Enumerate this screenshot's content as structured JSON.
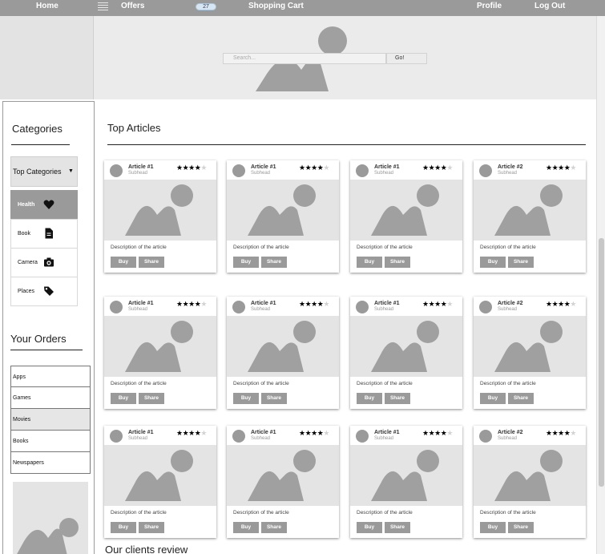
{
  "nav": {
    "home": "Home",
    "offers": "Offers",
    "cart_count": "27",
    "shopping_cart": "Shopping Cart",
    "profile": "Profile",
    "logout": "Log Out"
  },
  "search": {
    "placeholder": "Search...",
    "button": "Go!"
  },
  "sidebar": {
    "categories_title": "Categories",
    "dropdown_label": "Top Categories",
    "categories": [
      {
        "label": "Health",
        "icon": "heart-icon"
      },
      {
        "label": "Book",
        "icon": "document-icon"
      },
      {
        "label": "Camera",
        "icon": "camera-icon"
      },
      {
        "label": "Places",
        "icon": "tag-icon"
      }
    ],
    "orders_title": "Your Orders",
    "orders": [
      "Apps",
      "Games",
      "Movies",
      "Books",
      "Newspapers"
    ],
    "selected_order": "Movies"
  },
  "main": {
    "title": "Top Articles",
    "clients_title": "Our clients review"
  },
  "articles": [
    {
      "title": "Article #1",
      "subhead": "Subhead",
      "rating": 4,
      "description": "Description of the article",
      "buy": "Buy",
      "share": "Share"
    },
    {
      "title": "Article #1",
      "subhead": "Subhead",
      "rating": 4,
      "description": "Description of the article",
      "buy": "Buy",
      "share": "Share"
    },
    {
      "title": "Article #1",
      "subhead": "Subhead",
      "rating": 4,
      "description": "Description of the article",
      "buy": "Buy",
      "share": "Share"
    },
    {
      "title": "Article #2",
      "subhead": "Subhead",
      "rating": 4,
      "description": "Description of the article",
      "buy": "Buy",
      "share": "Share"
    },
    {
      "title": "Article #1",
      "subhead": "Subhead",
      "rating": 4,
      "description": "Description of the article",
      "buy": "Buy",
      "share": "Share"
    },
    {
      "title": "Article #1",
      "subhead": "Subhead",
      "rating": 4,
      "description": "Description of the article",
      "buy": "Buy",
      "share": "Share"
    },
    {
      "title": "Article #1",
      "subhead": "Subhead",
      "rating": 4,
      "description": "Description of the article",
      "buy": "Buy",
      "share": "Share"
    },
    {
      "title": "Article #2",
      "subhead": "Subhead",
      "rating": 4,
      "description": "Description of the article",
      "buy": "Buy",
      "share": "Share"
    },
    {
      "title": "Article #1",
      "subhead": "Subhead",
      "rating": 4,
      "description": "Description of the article",
      "buy": "Buy",
      "share": "Share"
    },
    {
      "title": "Article #1",
      "subhead": "Subhead",
      "rating": 4,
      "description": "Description of the article",
      "buy": "Buy",
      "share": "Share"
    },
    {
      "title": "Article #1",
      "subhead": "Subhead",
      "rating": 4,
      "description": "Description of the article",
      "buy": "Buy",
      "share": "Share"
    },
    {
      "title": "Article #2",
      "subhead": "Subhead",
      "rating": 4,
      "description": "Description of the article",
      "buy": "Buy",
      "share": "Share"
    }
  ],
  "colors": {
    "nav_bg": "#9a9a9a",
    "placeholder_gray": "#a0a0a0",
    "placeholder_bg": "#e4e4e4",
    "hero_bg": "#ebebeb"
  }
}
